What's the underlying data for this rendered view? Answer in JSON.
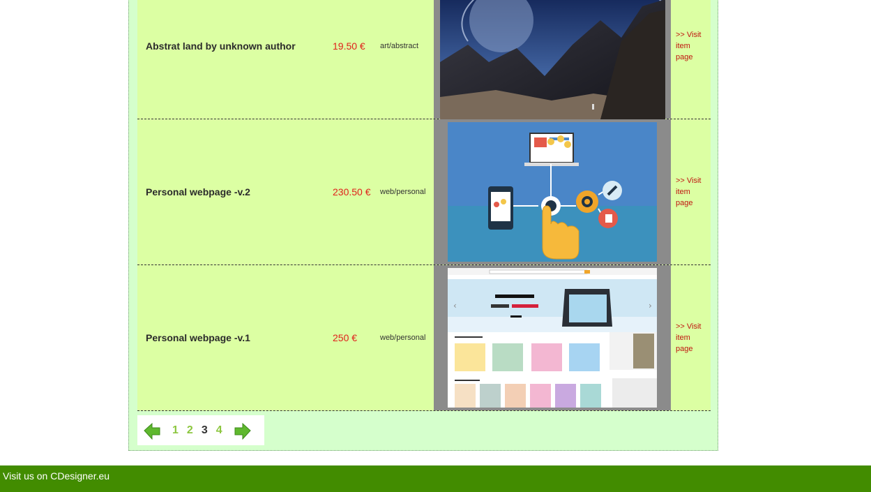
{
  "items": [
    {
      "title": "Abstrat land by unknown author",
      "price": "19.50 €",
      "category": "art/abstract",
      "link": ">> Visit item page",
      "image_icon": "mountain-landscape-image"
    },
    {
      "title": "Personal webpage -v.2",
      "price": "230.50 €",
      "category": "web/personal",
      "link": ">> Visit item page",
      "image_icon": "web-tech-illustration-image"
    },
    {
      "title": "Personal webpage -v.1",
      "price": "250 €",
      "category": "web/personal",
      "link": ">> Visit item page",
      "image_icon": "webshop-mockup-image"
    }
  ],
  "pagination": {
    "pages": [
      "1",
      "2",
      "3",
      "4"
    ],
    "current": "3",
    "prev_icon": "arrow-left-icon",
    "next_icon": "arrow-right-icon"
  },
  "footer": {
    "text": "Visit us on CDesigner.eu"
  },
  "colors": {
    "row_bg": "#dcffa3",
    "container_bg": "#d5ffcc",
    "price": "#e0201b",
    "link": "#c0150f",
    "footer_bg": "#428c00",
    "page_link": "#8cc63f"
  }
}
